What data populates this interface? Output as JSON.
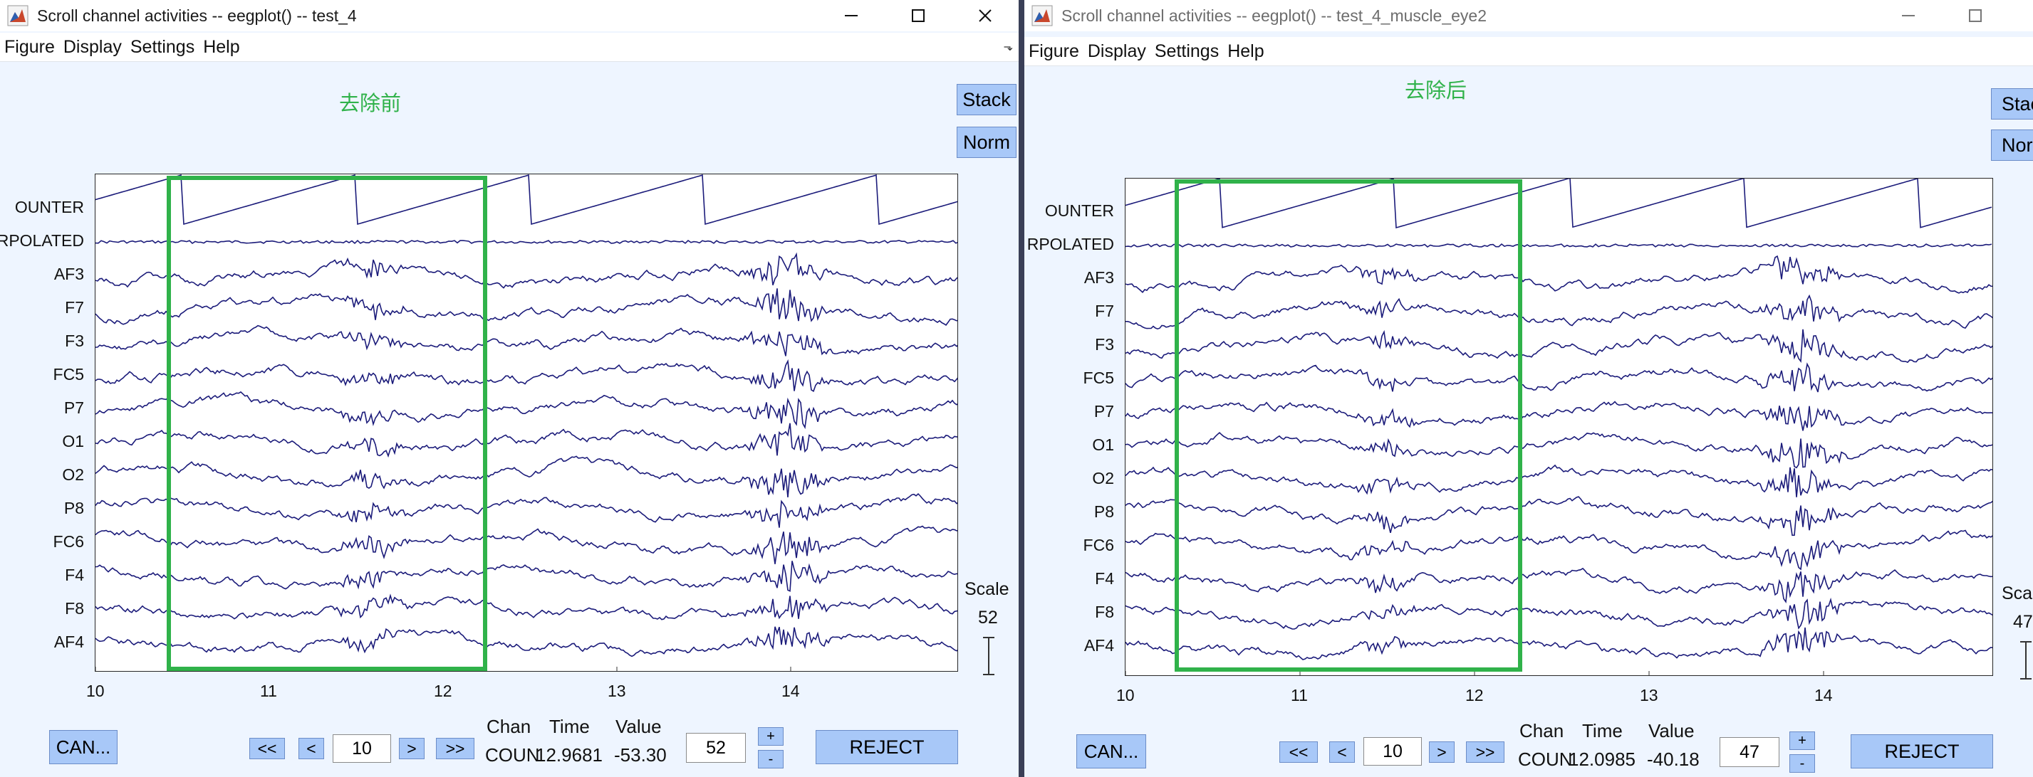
{
  "left": {
    "title": "Scroll channel activities -- eegplot() -- test_4",
    "menu": [
      "Figure",
      "Display",
      "Settings",
      "Help"
    ],
    "heading": "去除前",
    "stack_label": "Stack",
    "norm_label": "Norm",
    "channels": [
      "OUNTER",
      "RPOLATED",
      "AF3",
      "F7",
      "F3",
      "FC5",
      "P7",
      "O1",
      "O2",
      "P8",
      "FC6",
      "F4",
      "F8",
      "AF4"
    ],
    "x_ticks": [
      "10",
      "11",
      "12",
      "13",
      "14"
    ],
    "scale_label": "Scale",
    "scale_value": "52",
    "cancel_label": "CAN...",
    "nav": {
      "first": "<<",
      "prev": "<",
      "page": "10",
      "next": ">",
      "last": ">>"
    },
    "readout_header": {
      "chan": "Chan",
      "time": "Time",
      "value": "Value"
    },
    "readout": {
      "chan": "COUN",
      "time": "12.9681",
      "value": "-53.30"
    },
    "scale_input": "52",
    "plus": "+",
    "minus": "-",
    "reject_label": "REJECT"
  },
  "right": {
    "title": "Scroll channel activities -- eegplot() -- test_4_muscle_eye2",
    "menu": [
      "Figure",
      "Display",
      "Settings",
      "Help"
    ],
    "heading": "去除后",
    "stack_label": "Stac",
    "norm_label": "Norn",
    "channels": [
      "OUNTER",
      "RPOLATED",
      "AF3",
      "F7",
      "F3",
      "FC5",
      "P7",
      "O1",
      "O2",
      "P8",
      "FC6",
      "F4",
      "F8",
      "AF4"
    ],
    "x_ticks": [
      "10",
      "11",
      "12",
      "13",
      "14"
    ],
    "scale_label": "Sca",
    "scale_value": "47",
    "cancel_label": "CAN...",
    "nav": {
      "first": "<<",
      "prev": "<",
      "page": "10",
      "next": ">",
      "last": ">>"
    },
    "readout_header": {
      "chan": "Chan",
      "time": "Time",
      "value": "Value"
    },
    "readout": {
      "chan": "COUN",
      "time": "12.0985",
      "value": "-40.18"
    },
    "scale_input": "47",
    "plus": "+",
    "minus": "-",
    "reject_label": "REJECT"
  },
  "colors": {
    "trace": "#1b1b7a",
    "highlight": "#30b24a",
    "button": "#a8c8f8"
  },
  "icons": [
    "matlab-figure-icon",
    "minimize-icon",
    "maximize-icon",
    "close-icon",
    "scale-bar-icon"
  ]
}
